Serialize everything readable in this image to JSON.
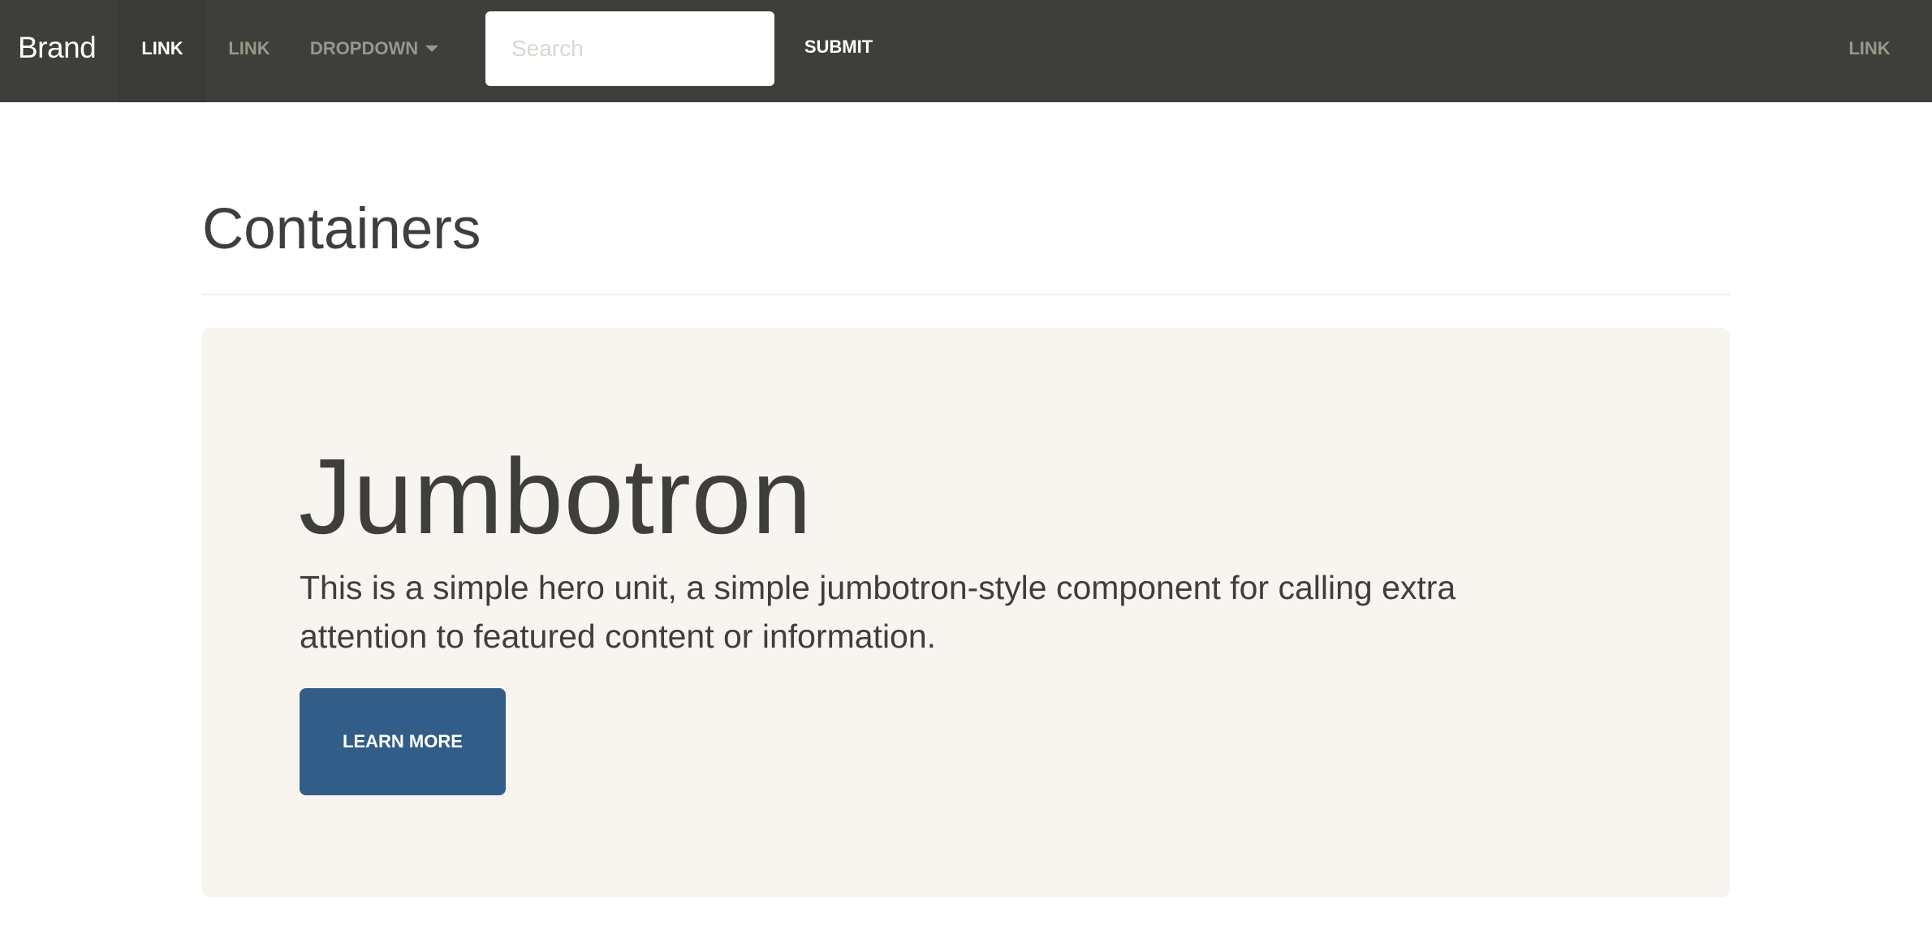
{
  "navbar": {
    "brand": "Brand",
    "links": [
      {
        "label": "Link",
        "active": true
      },
      {
        "label": "Link",
        "active": false
      }
    ],
    "dropdown_label": "Dropdown",
    "search": {
      "placeholder": "Search",
      "value": ""
    },
    "submit_label": "Submit",
    "right_link_label": "Link"
  },
  "main": {
    "page_title": "Containers",
    "jumbotron": {
      "title": "Jumbotron",
      "text": "This is a simple hero unit, a simple jumbotron-style component for calling extra attention to featured content or information.",
      "button_label": "Learn more"
    }
  },
  "colors": {
    "navbar_bg": "#3e3f3a",
    "navbar_link": "#98978b",
    "jumbotron_bg": "#f8f5f0",
    "primary": "#325d88",
    "text": "#3e3f3a"
  }
}
